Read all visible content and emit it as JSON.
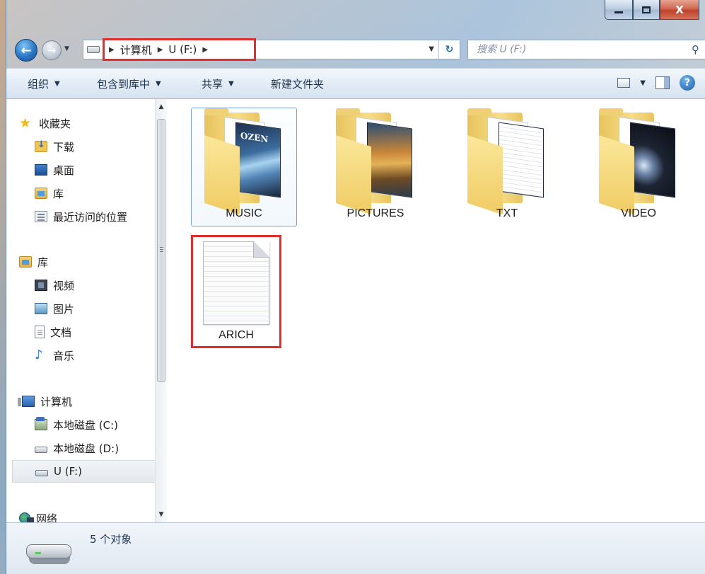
{
  "window": {
    "caption_min": "–",
    "caption_max": "□",
    "caption_close": "X"
  },
  "address": {
    "crumbs": [
      "计算机",
      "U (F:)"
    ],
    "nav_back": "←",
    "nav_fwd": "→",
    "refresh": "↻"
  },
  "search": {
    "placeholder": "搜索 U (F:)",
    "icon": "search-icon"
  },
  "toolbar": {
    "organize": "组织",
    "include_library": "包含到库中",
    "share": "共享",
    "new_folder": "新建文件夹",
    "help": "?"
  },
  "sidebar": {
    "favorites": {
      "label": "收藏夹",
      "items": [
        "下载",
        "桌面",
        "库",
        "最近访问的位置"
      ]
    },
    "libraries": {
      "label": "库",
      "items": [
        "视频",
        "图片",
        "文档",
        "音乐"
      ]
    },
    "computer": {
      "label": "计算机",
      "items": [
        "本地磁盘 (C:)",
        "本地磁盘 (D:)",
        "U (F:)"
      ]
    },
    "network": {
      "label": "网络"
    }
  },
  "files": [
    {
      "name": "MUSIC",
      "type": "folder"
    },
    {
      "name": "PICTURES",
      "type": "folder"
    },
    {
      "name": "TXT",
      "type": "folder"
    },
    {
      "name": "VIDEO",
      "type": "folder"
    },
    {
      "name": "ARICH",
      "type": "file"
    }
  ],
  "details": {
    "count": "5 个对象"
  },
  "colors": {
    "highlight_red": "#e32c2c",
    "folder_yellow": "#f0cf6e",
    "selection_blue": "#7da2ce"
  }
}
